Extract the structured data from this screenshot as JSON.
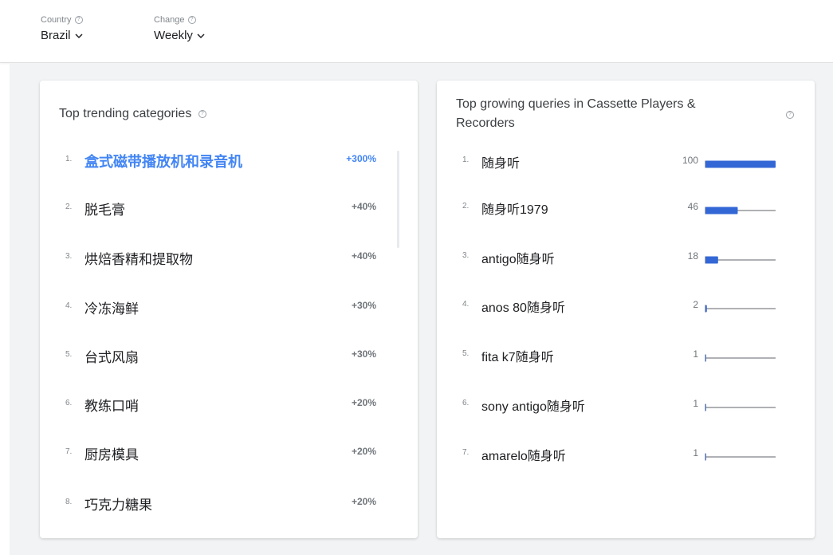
{
  "filters": {
    "country": {
      "label": "Country",
      "value": "Brazil"
    },
    "change": {
      "label": "Change",
      "value": "Weekly"
    }
  },
  "left_card": {
    "title": "Top trending categories",
    "items": [
      {
        "rank": "1.",
        "name": "盒式磁带播放机和录音机",
        "change": "+300%"
      },
      {
        "rank": "2.",
        "name": "脱毛膏",
        "change": "+40%"
      },
      {
        "rank": "3.",
        "name": "烘焙香精和提取物",
        "change": "+40%"
      },
      {
        "rank": "4.",
        "name": "冷冻海鲜",
        "change": "+30%"
      },
      {
        "rank": "5.",
        "name": "台式风扇",
        "change": "+30%"
      },
      {
        "rank": "6.",
        "name": "教练口哨",
        "change": "+20%"
      },
      {
        "rank": "7.",
        "name": "厨房模具",
        "change": "+20%"
      },
      {
        "rank": "8.",
        "name": "巧克力糖果",
        "change": "+20%"
      }
    ]
  },
  "right_card": {
    "title": "Top growing queries in Cassette Players & Recorders",
    "items": [
      {
        "rank": "1.",
        "query": "随身听",
        "value": 100
      },
      {
        "rank": "2.",
        "query": "随身听1979",
        "value": 46
      },
      {
        "rank": "3.",
        "query": "antigo随身听",
        "value": 18
      },
      {
        "rank": "4.",
        "query": "anos 80随身听",
        "value": 2
      },
      {
        "rank": "5.",
        "query": "fita k7随身听",
        "value": 1
      },
      {
        "rank": "6.",
        "query": "sony antigo随身听",
        "value": 1
      },
      {
        "rank": "7.",
        "query": "amarelo随身听",
        "value": 1
      }
    ]
  },
  "colors": {
    "accent": "#4285f4",
    "bar_fill": "#3367d6",
    "bar_track": "#5f6368"
  }
}
